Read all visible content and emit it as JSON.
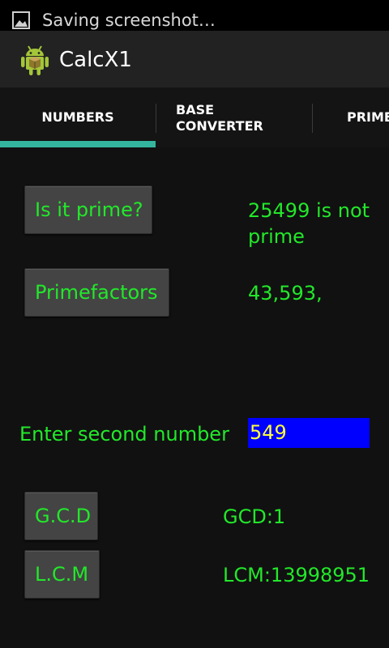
{
  "status_bar": {
    "notification_text": "Saving screenshot…",
    "icon": "image-icon"
  },
  "action_bar": {
    "title": "CalcX1",
    "icon": "android-icon"
  },
  "tabs": [
    {
      "label": "NUMBERS",
      "selected": true
    },
    {
      "label_line1": "BASE",
      "label_line2": "CONVERTER",
      "selected": false
    },
    {
      "label": "PRIME",
      "selected": false
    }
  ],
  "prime_check": {
    "button_label": "Is it prime?",
    "result_line1": "25499 is not",
    "result_line2": "prime"
  },
  "prime_factors": {
    "button_label": "Primefactors",
    "result": "43,593,"
  },
  "second_number": {
    "label": "Enter second number",
    "value": "549"
  },
  "gcd": {
    "button_label": "G.C.D",
    "result": "GCD:1"
  },
  "lcm": {
    "button_label": "L.C.M",
    "result": "LCM:13998951"
  },
  "colors": {
    "accent_green": "#22e82a",
    "tab_indicator": "#33b59f",
    "input_background": "#0000ff",
    "input_text": "#ffff3a"
  }
}
